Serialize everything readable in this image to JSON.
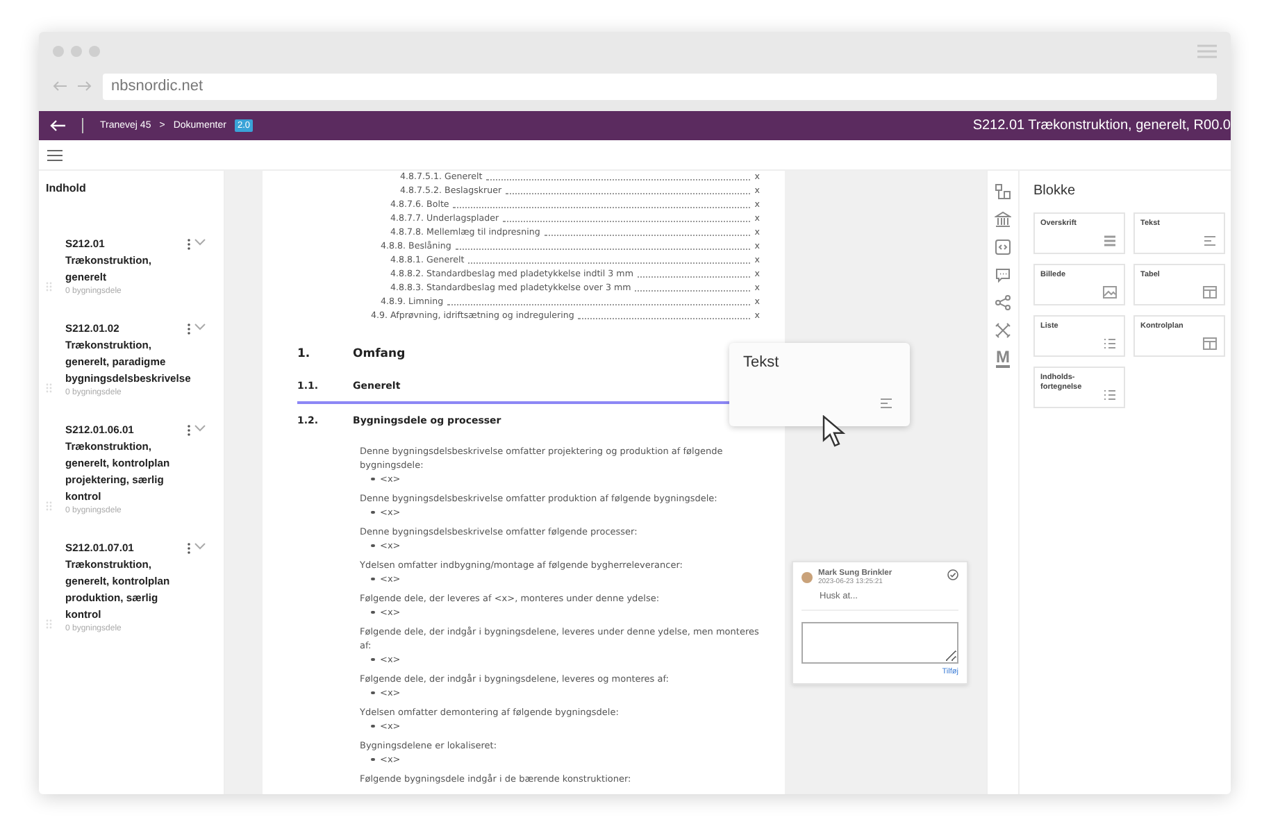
{
  "browser": {
    "url": "nbsnordic.net"
  },
  "header": {
    "breadcrumb": [
      "Tranevej 45",
      "Dokumenter"
    ],
    "separator": ">",
    "badge": "2.0",
    "title": "S212.01 Trækonstruktion, generelt, R00.0"
  },
  "sidebar": {
    "title": "Indhold",
    "items": [
      {
        "code": "S212.01",
        "title": "Trækonstruktion, generelt",
        "count": "0 bygningsdele"
      },
      {
        "code": "S212.01.02",
        "title": "Trækonstruktion, generelt, paradigme bygningsdelsbeskrivelse",
        "count": "0 bygningsdele"
      },
      {
        "code": "S212.01.06.01",
        "title": "Trækonstruktion, generelt, kontrolplan projektering, særlig kontrol",
        "count": "0 bygningsdele"
      },
      {
        "code": "S212.01.07.01",
        "title": "Trækonstruktion, generelt, kontrolplan produktion, særlig kontrol",
        "count": "0 bygningsdele"
      }
    ]
  },
  "document": {
    "toc": [
      {
        "children": [
          {
            "children": [
              {
                "children": [
                  {
                    "label": "4.8.7.5.1. Generelt",
                    "page": "x"
                  },
                  {
                    "label": "4.8.7.5.2. Beslagskruer",
                    "page": "x"
                  }
                ]
              },
              {
                "label": "4.8.7.6. Bolte",
                "page": "x"
              },
              {
                "label": "4.8.7.7. Underlagsplader",
                "page": "x"
              },
              {
                "label": "4.8.7.8. Mellemlæg til indpresning",
                "page": "x"
              }
            ]
          },
          {
            "label": "4.8.8. Beslåning",
            "page": "x",
            "children": [
              {
                "label": "4.8.8.1. Generelt",
                "page": "x"
              },
              {
                "label": "4.8.8.2. Standardbeslag med pladetykkelse indtil 3 mm",
                "page": "x"
              },
              {
                "label": "4.8.8.3. Standardbeslag med pladetykkelse over 3 mm",
                "page": "x"
              }
            ]
          },
          {
            "label": "4.8.9. Limning",
            "page": "x"
          }
        ]
      },
      {
        "label": "4.9. Afprøvning, idriftsætning og indregulering",
        "page": "x"
      }
    ],
    "headings": [
      {
        "kind": "chapter",
        "number": "1.",
        "title": "Omfang"
      },
      {
        "kind": "section",
        "number": "1.1.",
        "title": "Generelt"
      },
      {
        "kind": "section",
        "number": "1.2.",
        "title": "Bygningsdele og processer"
      }
    ],
    "paragraphs": [
      {
        "text": "Denne bygningsdelsbeskrivelse omfatter projektering og produktion af følgende bygningsdele:",
        "bullets": [
          "<x>"
        ]
      },
      {
        "text": "Denne bygningsdelsbeskrivelse omfatter produktion af følgende bygningsdele:",
        "bullets": [
          "<x>"
        ]
      },
      {
        "text": "Denne bygningsdelsbeskrivelse omfatter følgende processer:",
        "bullets": [
          "<x>"
        ]
      },
      {
        "text": "Ydelsen omfatter indbygning/montage af følgende bygherreleverancer:",
        "bullets": [
          "<x>"
        ]
      },
      {
        "text": "Følgende dele, der leveres af <x>, monteres under denne ydelse:",
        "bullets": [
          "<x>"
        ]
      },
      {
        "text": "Følgende dele, der indgår i bygningsdelene, leveres under denne ydelse, men monteres af:",
        "bullets": [
          "<x>"
        ]
      },
      {
        "text": "Følgende dele, der indgår i bygningsdelene, leveres og monteres af:",
        "bullets": [
          "<x>"
        ]
      },
      {
        "text": "Ydelsen omfatter demontering af følgende bygningsdele:",
        "bullets": [
          "<x>"
        ]
      },
      {
        "text": "Bygningsdelene er lokaliseret:",
        "bullets": [
          "<x>"
        ]
      },
      {
        "text": "Følgende bygningsdele indgår i de bærende konstruktioner:"
      }
    ]
  },
  "drag_card": {
    "label": "Tekst",
    "kind": "text"
  },
  "comment": {
    "author": "Mark Sung Brinkler",
    "date": "2023-06-23 13:25:21",
    "text": "Husk at...",
    "action": "Tilføj"
  },
  "rail": {
    "letter": "M"
  },
  "blocks": {
    "title": "Blokke",
    "items": [
      {
        "label": "Overskrift",
        "kind": "heading"
      },
      {
        "label": "Tekst",
        "kind": "text"
      },
      {
        "label": "Billede",
        "kind": "image"
      },
      {
        "label": "Tabel",
        "kind": "table"
      },
      {
        "label": "Liste",
        "kind": "list"
      },
      {
        "label": "Kontrolplan",
        "kind": "table"
      },
      {
        "label": "Indholds-\nfortegnelse",
        "kind": "list"
      }
    ]
  }
}
